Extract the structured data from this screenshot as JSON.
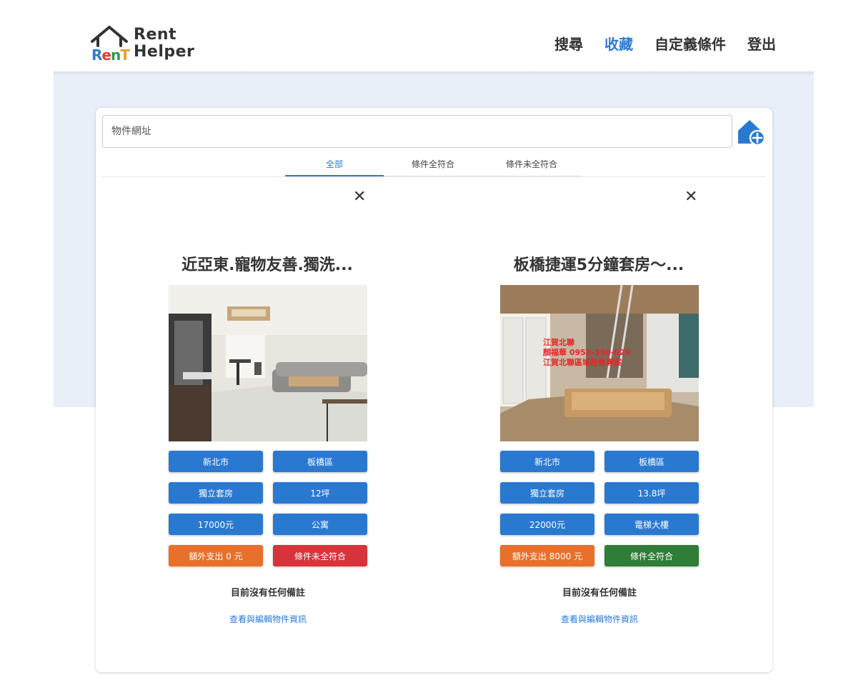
{
  "header": {
    "brand_top": "Rent",
    "brand_bottom": "Helper",
    "brand_mark": "RenT",
    "nav": [
      {
        "label": "搜尋",
        "active": false
      },
      {
        "label": "收藏",
        "active": true
      },
      {
        "label": "自定義條件",
        "active": false
      },
      {
        "label": "登出",
        "active": false
      }
    ]
  },
  "search": {
    "placeholder": "物件網址",
    "value": ""
  },
  "tabs": [
    {
      "label": "全部",
      "active": true
    },
    {
      "label": "條件全符合",
      "active": false
    },
    {
      "label": "條件未全符合",
      "active": false
    }
  ],
  "properties": [
    {
      "title": "近亞東.寵物友善.獨洗...",
      "chips": [
        {
          "label": "新北市",
          "color": "blue"
        },
        {
          "label": "板橋區",
          "color": "blue"
        },
        {
          "label": "獨立套房",
          "color": "blue"
        },
        {
          "label": "12坪",
          "color": "blue"
        },
        {
          "label": "17000元",
          "color": "blue"
        },
        {
          "label": "公寓",
          "color": "blue"
        },
        {
          "label": "額外支出 0 元",
          "color": "orange"
        },
        {
          "label": "條件未全符合",
          "color": "red"
        }
      ],
      "note": "目前沒有任何備註",
      "edit_link": "查看與編輯物件資訊"
    },
    {
      "title": "板橋捷運5分鐘套房～...",
      "chips": [
        {
          "label": "新北市",
          "color": "blue"
        },
        {
          "label": "板橋區",
          "color": "blue"
        },
        {
          "label": "獨立套房",
          "color": "blue"
        },
        {
          "label": "13.8坪",
          "color": "blue"
        },
        {
          "label": "22000元",
          "color": "blue"
        },
        {
          "label": "電梯大樓",
          "color": "blue"
        },
        {
          "label": "額外支出 8000 元",
          "color": "orange"
        },
        {
          "label": "條件全符合",
          "color": "green"
        }
      ],
      "note": "目前沒有任何備註",
      "edit_link": "查看與編輯物件資訊"
    }
  ],
  "colors": {
    "accent": "#2d7bd3",
    "chip_blue": "#2a79d1",
    "chip_orange": "#e8702a",
    "chip_red": "#d6333b",
    "chip_green": "#2f7d36",
    "panel_bg": "#e8eff8"
  }
}
